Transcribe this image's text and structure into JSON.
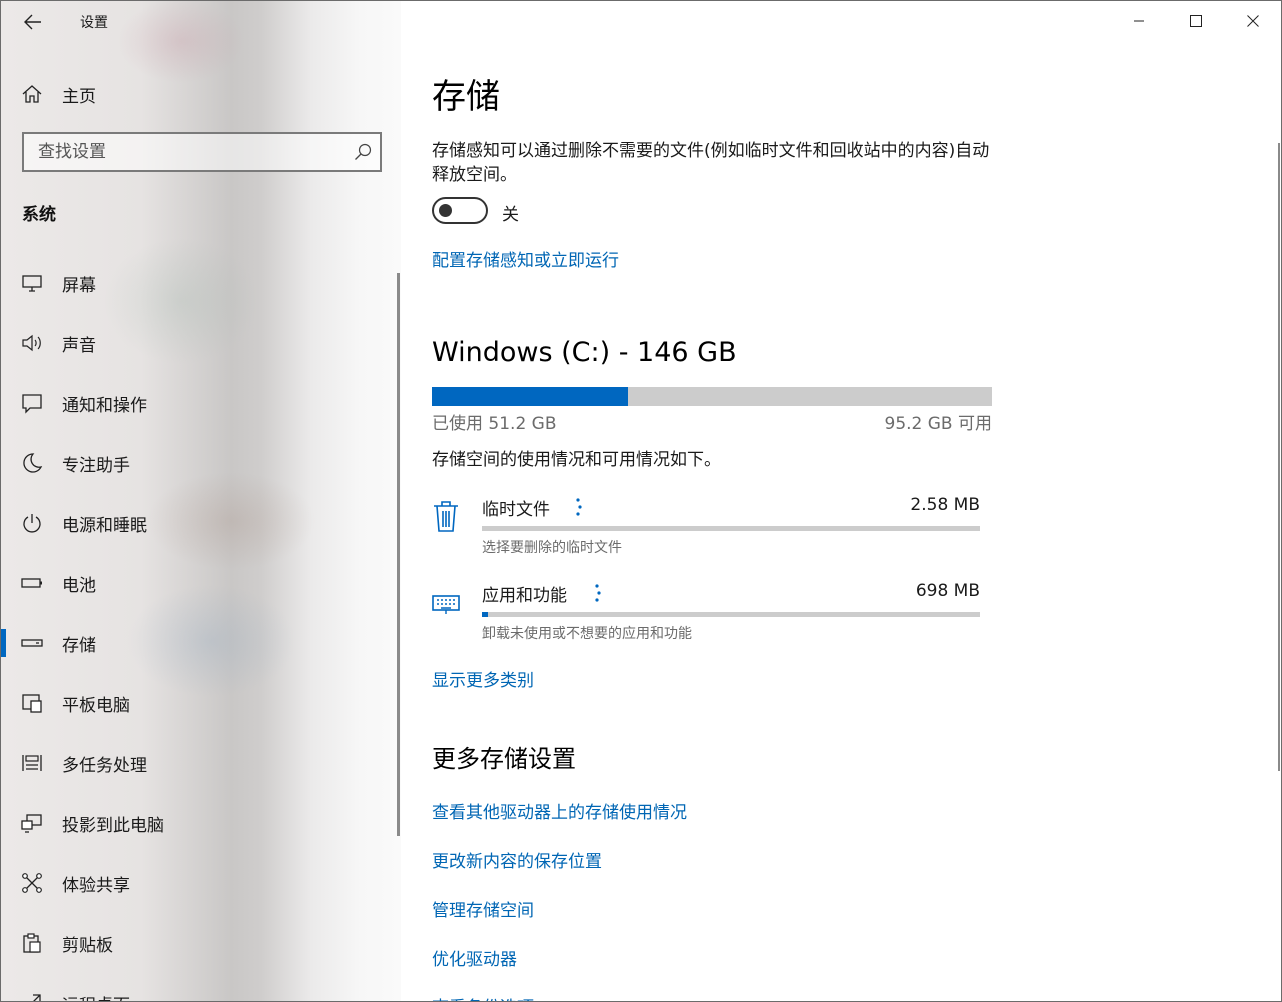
{
  "window": {
    "title": "设置",
    "controls": [
      "minimize-icon",
      "maximize-icon",
      "close-icon"
    ]
  },
  "sidebar": {
    "home_label": "主页",
    "search": {
      "placeholder": "查找设置",
      "value": ""
    },
    "section_title": "系统",
    "items": [
      {
        "label": "屏幕",
        "icon": "monitor-icon"
      },
      {
        "label": "声音",
        "icon": "speaker-icon"
      },
      {
        "label": "通知和操作",
        "icon": "notification-icon"
      },
      {
        "label": "专注助手",
        "icon": "moon-icon"
      },
      {
        "label": "电源和睡眠",
        "icon": "power-icon"
      },
      {
        "label": "电池",
        "icon": "battery-icon"
      },
      {
        "label": "存储",
        "icon": "storage-drive-icon",
        "active": true
      },
      {
        "label": "平板电脑",
        "icon": "tablet-icon"
      },
      {
        "label": "多任务处理",
        "icon": "multitasking-icon"
      },
      {
        "label": "投影到此电脑",
        "icon": "projecting-icon"
      },
      {
        "label": "体验共享",
        "icon": "shared-experiences-icon"
      },
      {
        "label": "剪贴板",
        "icon": "clipboard-icon"
      },
      {
        "label": "远程桌面",
        "icon": "remote-desktop-icon"
      }
    ]
  },
  "main": {
    "title": "存储",
    "storage_sense_description": "存储感知可以通过删除不需要的文件(例如临时文件和回收站中的内容)自动释放空间。",
    "storage_sense_toggle": {
      "state": "off",
      "label": "关"
    },
    "configure_link": "配置存储感知或立即运行",
    "drive": {
      "title": "Windows (C:) - 146 GB",
      "used_label": "已使用 51.2 GB",
      "free_label": "95.2 GB 可用",
      "used_fraction": 0.35
    },
    "usage_intro": "存储空间的使用情况和可用情况如下。",
    "categories": [
      {
        "name": "临时文件",
        "size": "2.58 MB",
        "subtitle": "选择要删除的临时文件",
        "icon": "trash-icon",
        "fraction": 0.0
      },
      {
        "name": "应用和功能",
        "size": "698 MB",
        "subtitle": "卸载未使用或不想要的应用和功能",
        "icon": "apps-keyboard-icon",
        "fraction": 0.013
      }
    ],
    "show_more_link": "显示更多类别",
    "more_settings_title": "更多存储设置",
    "more_links": [
      "查看其他驱动器上的存储使用情况",
      "更改新内容的保存位置",
      "管理存储空间",
      "优化驱动器",
      "查看备份选项"
    ]
  },
  "colors": {
    "accent": "#0067c0",
    "link": "#0066b4",
    "bar_track": "#cccccc",
    "secondary_text": "#6b6b6b"
  }
}
